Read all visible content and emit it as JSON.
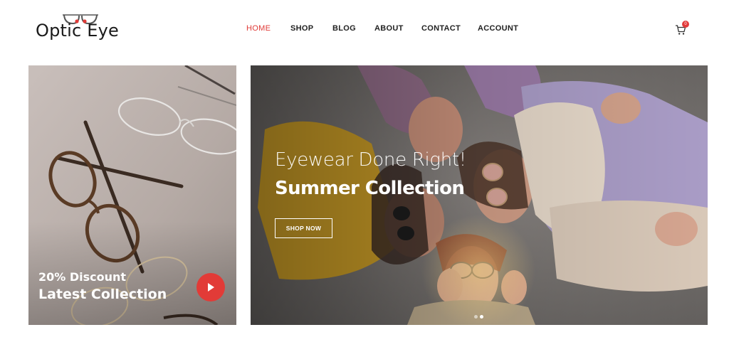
{
  "logo": {
    "text": "Optic Eye",
    "accent_color": "#e03a37"
  },
  "nav": {
    "items": [
      {
        "label": "HOME",
        "active": true
      },
      {
        "label": "SHOP",
        "active": false
      },
      {
        "label": "BLOG",
        "active": false
      },
      {
        "label": "ABOUT",
        "active": false
      },
      {
        "label": "CONTACT",
        "active": false
      },
      {
        "label": "ACCOUNT",
        "active": false
      }
    ],
    "active_color": "#e03a37"
  },
  "cart": {
    "icon": "cart-icon",
    "count": "0"
  },
  "promo": {
    "line1": "20% Discount",
    "line2": "Latest Collection",
    "play_icon": "play-icon",
    "button_color": "#e23b37"
  },
  "hero": {
    "tagline": "Eyewear Done Right!",
    "title": "Summer Collection",
    "button_label": "SHOP NOW",
    "slides": 2,
    "active_slide": 1
  }
}
